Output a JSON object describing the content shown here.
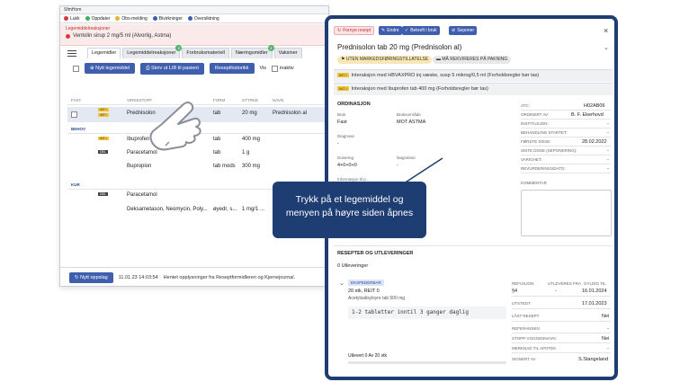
{
  "window": {
    "title": "SfmHom",
    "menu": [
      {
        "label": "Lukk",
        "color": "#d63b3b"
      },
      {
        "label": "Oppdater",
        "color": "#3bb25a"
      },
      {
        "label": "Obs-melding",
        "color": "#e6b22e"
      },
      {
        "label": "Bivirkninger",
        "color": "#3f5fae"
      },
      {
        "label": "Oversiktning",
        "color": "#3f5fae"
      }
    ]
  },
  "reaction_bar": {
    "label": "Legemiddelreaksjoner",
    "text": "Ventolin sirup 2 mg/5 ml (Alvorlig, Astma)"
  },
  "tabs": [
    {
      "label": "Legemidler",
      "badge": ""
    },
    {
      "label": "Legemiddelreaksjoner",
      "badge": "1"
    },
    {
      "label": "Forbruksmateriell",
      "badge": ""
    },
    {
      "label": "Næringsmidler",
      "badge": "1"
    },
    {
      "label": "Vaksiner",
      "badge": ""
    }
  ],
  "toolbar": {
    "new_label": "Nytt legemiddel",
    "print_label": "Skriv ut LIB til pasient",
    "history_label": "Resepthistorikk",
    "show_label": "Vis",
    "inactive_label": "inaktiv"
  },
  "columns": {
    "c1": "FAST",
    "c2": "VIRKESTOFF",
    "c3": "FORM",
    "c4": "STYRKE",
    "c5": "NAVN"
  },
  "sections": {
    "fast": "FAST",
    "behov": "BEHOV",
    "kur": "KUR"
  },
  "rows": {
    "r1": {
      "tag1": "INT I",
      "tag2": "INT I",
      "name": "Prednisolon",
      "form": "tab",
      "strength": "20 mg",
      "trade": "Prednisolon al"
    },
    "r2": {
      "tag1": "INT I",
      "name": "Ibuprofen",
      "form": "tab",
      "strength": "400 mg"
    },
    "r3": {
      "tag1": "DBL",
      "name": "Paracetamol",
      "form": "tab",
      "strength": "1 g"
    },
    "r4": {
      "name": "Bupropion",
      "form": "tab mods",
      "strength": "300 mg"
    },
    "r5": {
      "tag1": "DBL",
      "name": "Paracetamol",
      "form": "tab",
      "strength": "1 g"
    },
    "r6": {
      "name": "Deksametason, Neomycin, Poly...",
      "form": "øyedr, s...",
      "strength": "1 mg/1 ..."
    }
  },
  "status": {
    "button": "Nytt oppslag",
    "time": "11.01.23 14:03:54",
    "text": "Hentet opplysninger fra Reseptformidleren og Kjernejournal."
  },
  "panel": {
    "tools": {
      "t1": "Fornye resept",
      "t2": "Endre",
      "t3": "Bekreft i bruk",
      "t4": "Seponer"
    },
    "title": "Prednisolon tab 20 mg (Prednisolon al)",
    "pill1": "UTEN MARKEDSFØRINGSTILLATELSE",
    "pill2": "MÅ REKVIRERES PÅ PAKNING",
    "interactions": {
      "tag": "INT I",
      "i1": "Interaksjon med HBVAXPRO inj væske, susp 5 mikrog/0,5 ml (Forholdsregler bør tas)",
      "i2": "Interaksjon med Ibuprofen tab 400 mg (Forholdsregler bør tas)"
    },
    "ordinasjon": {
      "heading": "ORDINASJON",
      "bruk_l": "Bruk",
      "bruk_v": "Fast",
      "omr_l": "Bruksområde",
      "omr_v": "MOT ASTMA",
      "diag_l": "Diagnose",
      "diag_v": "-",
      "dos_l": "Dosering",
      "dos_v": "4+0+0+0",
      "dd_l": "Døgndose",
      "dd_v": "-",
      "info_l": "Informasjon til p..."
    },
    "kv": {
      "atc_l": "ATC:",
      "atc_v": "H02AB06",
      "ord_l": "ORDINERT AV:",
      "ord_v": "B. F. Ekerhovd",
      "inst_l": "INSTITUSJON:",
      "inst_v": "-",
      "start_l": "BEHANDLING STARTET:",
      "start_v": "-",
      "first_l": "FØRSTE DOSE:",
      "first_v": "28.02.2022",
      "last_l": "SISTE DOSE (SEPONERING):",
      "last_v": "-",
      "var_l": "VARIGHET:",
      "var_v": "-",
      "rev_l": "REVURDERINGSDATO:",
      "rev_v": "-",
      "comment_l": "KOMMENTAR"
    },
    "resepter": {
      "heading": "RESEPTER OG UTLEVERINGER",
      "count": "0 Utleveringer",
      "status": "EKSPEDERBAR",
      "amount": "20 stk, REIT 0",
      "package": "Acetylsalisylsyre tab 500 mg",
      "dosage_text": "1-2 tabletter inntil 3 ganger daglig",
      "delivered": "Utlevert 0 Av 20 stk",
      "progress_pct": 0,
      "refusjon_l": "REFUSJON",
      "refusjon_v": "§4",
      "utlev_l": "UTLEVERES FRA",
      "utlev_v": "-",
      "gyldig_l": "GYLDIG TIL",
      "gyldig_v": "16.01.2024",
      "utstedt_l": "UTSTEDT",
      "utstedt_v": "17.01.2023",
      "last_l": "LÅST RESEPT",
      "last_v": "Nei",
      "ref_l": "REFERANSEN",
      "ref_v": "-",
      "stopp_l": "STOPP-VOGGENNAVN:",
      "stopp_v": "Nei",
      "merk_l": "MERKNAD TIL APOTEK",
      "merk_v": "-",
      "sign_l": "SIGNERT AV",
      "sign_v": "S.Stangeland"
    }
  },
  "callout": {
    "line1": "Trykk på et legemiddel og",
    "line2": "menyen på høyre siden åpnes"
  },
  "colors": {
    "primary": "#3f5fae",
    "navy": "#1e3d73",
    "warning": "#f4c531"
  }
}
